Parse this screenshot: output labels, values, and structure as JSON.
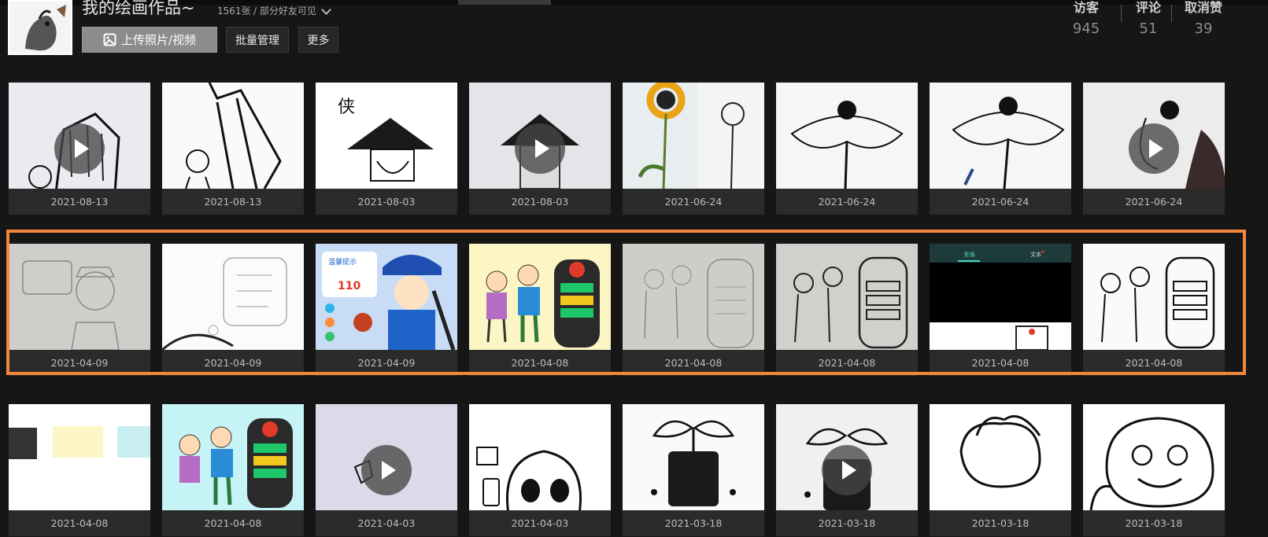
{
  "album": {
    "title": "我的绘画作品~",
    "count": "1561张",
    "visibility": "/ 部分好友可见"
  },
  "toolbar": {
    "upload_label": "上传照片/视频",
    "batch_label": "批量管理",
    "more_label": "更多"
  },
  "stats": [
    {
      "label": "访客",
      "value": "945"
    },
    {
      "label": "评论",
      "value": "51"
    },
    {
      "label": "取消赞",
      "value": "39"
    }
  ],
  "photos": {
    "row1": [
      {
        "date": "2021-08-13",
        "video": true
      },
      {
        "date": "2021-08-13",
        "video": false
      },
      {
        "date": "2021-08-03",
        "video": false
      },
      {
        "date": "2021-08-03",
        "video": true
      },
      {
        "date": "2021-06-24",
        "video": false
      },
      {
        "date": "2021-06-24",
        "video": false
      },
      {
        "date": "2021-06-24",
        "video": false
      },
      {
        "date": "2021-06-24",
        "video": true
      }
    ],
    "row2": [
      {
        "date": "2021-04-09",
        "video": false
      },
      {
        "date": "2021-04-09",
        "video": false
      },
      {
        "date": "2021-04-09",
        "video": false
      },
      {
        "date": "2021-04-08",
        "video": false
      },
      {
        "date": "2021-04-08",
        "video": false
      },
      {
        "date": "2021-04-08",
        "video": false
      },
      {
        "date": "2021-04-08",
        "video": false
      },
      {
        "date": "2021-04-08",
        "video": false
      }
    ],
    "row3": [
      {
        "date": "2021-04-08",
        "video": false
      },
      {
        "date": "2021-04-08",
        "video": false
      },
      {
        "date": "2021-04-03",
        "video": true
      },
      {
        "date": "2021-04-03",
        "video": false
      },
      {
        "date": "2021-03-18",
        "video": false
      },
      {
        "date": "2021-03-18",
        "video": true
      },
      {
        "date": "2021-03-18",
        "video": false
      },
      {
        "date": "2021-03-18",
        "video": false
      }
    ]
  },
  "thumb_texts": {
    "row1_3": "侠",
    "row2_3_bubble": "温馨提示",
    "row2_3_number": "110",
    "row2_7_tab_a": "影像",
    "row2_7_tab_b": "文本"
  },
  "colors": {
    "background": "#161616",
    "selection": "#f0873b",
    "accent_blue": "#1e63c9"
  }
}
